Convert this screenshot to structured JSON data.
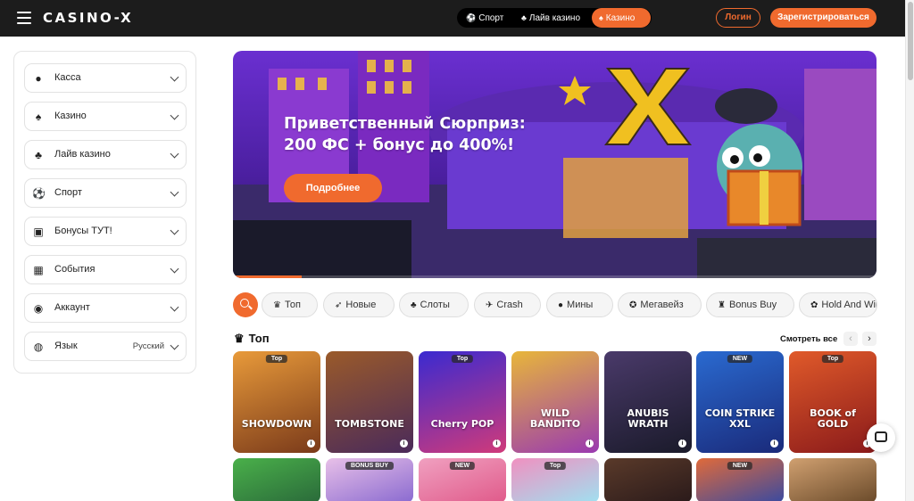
{
  "header": {
    "logo": "CASINO-X",
    "tabs": [
      {
        "label": "Спорт",
        "icon": "soccer-ball-icon",
        "active": false
      },
      {
        "label": "Лайв казино",
        "icon": "live-casino-icon",
        "active": false
      },
      {
        "label": "Казино",
        "icon": "casino-icon",
        "active": true
      }
    ],
    "login_label": "Логин",
    "register_label": "Зарегистрироваться"
  },
  "sidebar": {
    "items": [
      {
        "label": "Касса",
        "icon": "piggy-bank-icon"
      },
      {
        "label": "Казино",
        "icon": "casino-icon"
      },
      {
        "label": "Лайв казино",
        "icon": "live-casino-icon"
      },
      {
        "label": "Спорт",
        "icon": "soccer-ball-icon"
      },
      {
        "label": "Бонусы ТУТ!",
        "icon": "gift-icon"
      },
      {
        "label": "События",
        "icon": "calendar-icon"
      },
      {
        "label": "Аккаунт",
        "icon": "user-icon"
      },
      {
        "label": "Язык",
        "icon": "globe-icon",
        "value": "Русский"
      }
    ]
  },
  "banner": {
    "title_line1": "Приветственный Сюрприз:",
    "title_line2": "200 ФС + бонус до 400%!",
    "button_label": "Подробнее",
    "slide_progress": 0.107
  },
  "filters": [
    {
      "label": "Топ",
      "icon": "crown-icon"
    },
    {
      "label": "Новые",
      "icon": "rocket-icon"
    },
    {
      "label": "Слоты",
      "icon": "cherries-icon"
    },
    {
      "label": "Crash",
      "icon": "airplane-icon"
    },
    {
      "label": "Мины",
      "icon": "bomb-icon"
    },
    {
      "label": "Мегавейз",
      "icon": "megaways-icon"
    },
    {
      "label": "Bonus Buy",
      "icon": "bonus-buy-icon"
    },
    {
      "label": "Hold And Win",
      "icon": "hold-and-win-icon"
    }
  ],
  "section": {
    "title": "Топ",
    "see_all_label": "Смотреть все",
    "prev_arrow": "‹",
    "next_arrow": "›"
  },
  "games": [
    {
      "name": "SHOWDOWN",
      "badge": "Top",
      "colors": [
        "#e89a3a",
        "#7a3a1a"
      ]
    },
    {
      "name": "TOMBSTONE",
      "badge": "",
      "colors": [
        "#9a5a2a",
        "#4a2a5a"
      ]
    },
    {
      "name": "Cherry POP",
      "badge": "Top",
      "colors": [
        "#3a2ad0",
        "#d03a7a"
      ]
    },
    {
      "name": "WILD BANDITO",
      "badge": "",
      "colors": [
        "#e8b63a",
        "#9a3ab0"
      ]
    },
    {
      "name": "ANUBIS WRATH",
      "badge": "",
      "colors": [
        "#4a3a6a",
        "#1a1a2a"
      ]
    },
    {
      "name": "COIN STRIKE XXL",
      "badge": "NEW",
      "colors": [
        "#2a6ad0",
        "#1a2a7a"
      ]
    },
    {
      "name": "BOOK of GOLD",
      "badge": "Top",
      "colors": [
        "#e05a2a",
        "#8a1a1a"
      ]
    }
  ],
  "games_row2": [
    {
      "badge": "",
      "colors": [
        "#4ab04a",
        "#2a6a3a"
      ]
    },
    {
      "badge": "BONUS BUY",
      "colors": [
        "#e8c0e8",
        "#8a6ad0"
      ]
    },
    {
      "badge": "NEW",
      "colors": [
        "#f0a0c0",
        "#e05a8a"
      ]
    },
    {
      "badge": "Top",
      "colors": [
        "#f090c0",
        "#a0e0f0"
      ]
    },
    {
      "badge": "",
      "colors": [
        "#5a3a2a",
        "#2a1a1a"
      ]
    },
    {
      "badge": "NEW",
      "colors": [
        "#e06a3a",
        "#3a4aa0"
      ]
    },
    {
      "badge": "",
      "colors": [
        "#d0a070",
        "#6a4a2a"
      ]
    }
  ],
  "chat": {
    "icon": "chat-icon"
  },
  "colors": {
    "accent": "#f06a2e",
    "header_bg": "#1c1c1c"
  }
}
